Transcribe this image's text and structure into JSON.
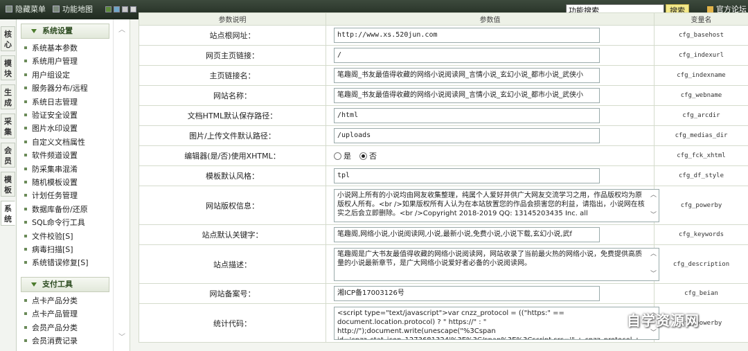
{
  "topbar": {
    "hide_menu": "隐藏菜单",
    "function_map": "功能地图",
    "search_value": "功能搜索",
    "search_button": "搜索",
    "forum": "官方论坛",
    "swatch_colors": [
      "#5c8a3a",
      "#6fa7c9",
      "#c8c8c8",
      "#d8d8d8"
    ]
  },
  "tabs": [
    "核心",
    "模块",
    "生成",
    "采集",
    "会员",
    "模板",
    "系统"
  ],
  "sidebar": {
    "group1": "系统设置",
    "items1": [
      "系统基本参数",
      "系统用户管理",
      "用户组设定",
      "服务器分布/远程",
      "系统日志管理",
      "验证安全设置",
      "图片水印设置",
      "自定义文档属性",
      "软件频道设置",
      "防采集串混淆",
      "随机模板设置",
      "计划任务管理",
      "数据库备份/还原",
      "SQL命令行工具",
      "文件校验[S]",
      "病毒扫描[S]",
      "系统错误修复[S]"
    ],
    "group2": "支付工具",
    "items2": [
      "点卡产品分类",
      "点卡产品管理",
      "会员产品分类",
      "会员消费记录"
    ]
  },
  "table": {
    "headers": [
      "参数说明",
      "参数值",
      "变量名"
    ],
    "rows": [
      {
        "label": "站点根网址：",
        "value": "http://www.xs.520jun.com",
        "var": "cfg_basehost"
      },
      {
        "label": "网页主页链接：",
        "value": "/",
        "var": "cfg_indexurl"
      },
      {
        "label": "主页链接名：",
        "value": "笔趣阁_书友最值得收藏的网络小说阅读网_言情小说_玄幻小说_都市小说_武侠小",
        "var": "cfg_indexname"
      },
      {
        "label": "网站名称：",
        "value": "笔趣阁_书友最值得收藏的网络小说阅读网_言情小说_玄幻小说_都市小说_武侠小",
        "var": "cfg_webname"
      },
      {
        "label": "文档HTML默认保存路径：",
        "value": "/html",
        "var": "cfg_arcdir"
      },
      {
        "label": "图片/上传文件默认路径：",
        "value": "/uploads",
        "var": "cfg_medias_dir"
      },
      {
        "label": "编辑器(是/否)使用XHTML：",
        "radio_yes": "是",
        "radio_no": "否",
        "var": "cfg_fck_xhtml"
      },
      {
        "label": "模板默认风格：",
        "value": "tpl",
        "var": "cfg_df_style"
      },
      {
        "label": "网站版权信息：",
        "area": "小说网上所有的小说均由网友收集整理，纯属个人爱好并供广大网友交流学习之用，作品版权均为原版权人所有。<br />如果版权所有人认为在本站放置您的作品会损害您的利益，请指出，小说网在核实之后会立即删除。<br />Copyright 2018-2019 QQ: 13145203435 Inc. all",
        "var": "cfg_powerby"
      },
      {
        "label": "站点默认关键字：",
        "value": "笔趣阁,网络小说,小说阅读网,小说,最新小说,免费小说,小说下载,玄幻小说,武f",
        "var": "cfg_keywords"
      },
      {
        "label": "站点描述：",
        "area": "笔趣阁是广大书友最值得收藏的网络小说阅读网，网站收录了当前最火热的网络小说，免费提供高质量的小说最新章节，是广大网络小说爱好者必备的小说阅读网。",
        "var": "cfg_description"
      },
      {
        "label": "网站备案号：",
        "value": "湘ICP备17003126号",
        "var": "cfg_beian"
      },
      {
        "label": "统计代码：",
        "area": "<script type=\"text/javascript\">var cnzz_protocol = ((\"https:\" == document.location.protocol) ? \" https://\" : \" http://\");document.write(unescape(\"%3Cspan id='cnzz_stat_icon_1273681324'%3E%3C/span%3E%3Cscript src='\" + cnzz_protocol + \"s19.cnzz.com/s_",
        "var": "cfg_powerby"
      }
    ]
  },
  "watermark": "自学资源网"
}
